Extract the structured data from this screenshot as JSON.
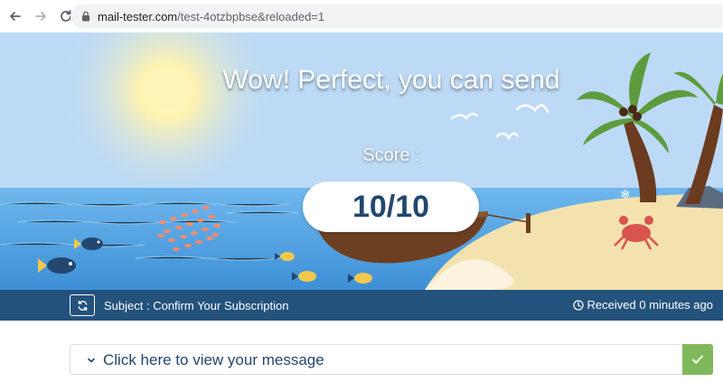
{
  "browser": {
    "url_host": "mail-tester.com",
    "url_path": "/test-4otzbpbse&reloaded=1"
  },
  "hero": {
    "headline": "Wow! Perfect, you can send",
    "score_label": "Score :",
    "score_value": "10/10"
  },
  "subject_bar": {
    "subject": "Subject : Confirm Your Subscription",
    "received": "Received 0 minutes ago"
  },
  "message": {
    "toggle_label": "Click here to view your message"
  },
  "colors": {
    "sky": "#bfdcf7",
    "sea": "#4a9fe0",
    "sand": "#f5e3b0",
    "bar": "#23527d",
    "score_text": "#23476e",
    "check_bg": "#7fb85a"
  },
  "icons": [
    "back-arrow-icon",
    "forward-arrow-icon",
    "reload-icon",
    "lock-icon",
    "refresh-icon",
    "clock-icon",
    "chevron-down-icon",
    "checkmark-icon"
  ]
}
